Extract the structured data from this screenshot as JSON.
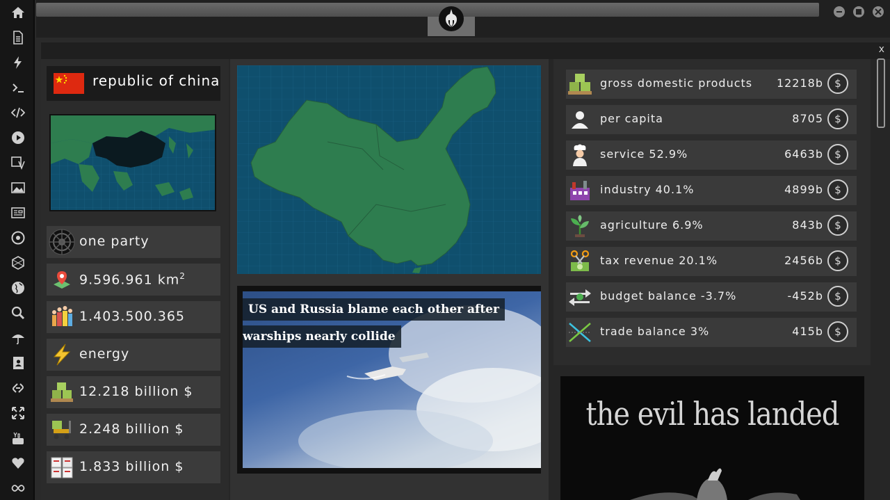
{
  "sidebar": {
    "items": [
      {
        "icon": "home-icon"
      },
      {
        "icon": "document-icon"
      },
      {
        "icon": "lightning-icon"
      },
      {
        "icon": "terminal-icon"
      },
      {
        "icon": "code-icon"
      },
      {
        "icon": "play-icon"
      },
      {
        "icon": "translate-icon"
      },
      {
        "icon": "image-icon"
      },
      {
        "icon": "news-icon"
      },
      {
        "icon": "empire-icon"
      },
      {
        "icon": "hexagon-icon"
      },
      {
        "icon": "globe-icon"
      },
      {
        "icon": "search-icon"
      },
      {
        "icon": "umbrella-icon"
      },
      {
        "icon": "contacts-icon"
      },
      {
        "icon": "link-icon"
      },
      {
        "icon": "fullscreen-icon"
      },
      {
        "icon": "youtube-icon"
      },
      {
        "icon": "heart-icon"
      },
      {
        "icon": "infinity-icon"
      }
    ]
  },
  "window": {
    "close_label": "x"
  },
  "country": {
    "name": "republic of china",
    "flag_color": "#de2910",
    "government": "one party",
    "area_value": "9.596.961 km",
    "area_sup": "2",
    "population": "1.403.500.365",
    "resource": "energy",
    "gdp": "12.218 billion $",
    "export": "2.248 billion $",
    "import": "1.833 billion $"
  },
  "news": {
    "headline_line1": "US and Russia blame each other after",
    "headline_line2": "warships nearly collide"
  },
  "economy": {
    "currency_symbol": "$",
    "rows": [
      {
        "label": "gross domestic products",
        "value": "12218b",
        "icon": "money-pallet-icon"
      },
      {
        "label": "per capita",
        "value": "8705",
        "icon": "person-icon"
      },
      {
        "label": "service 52.9%",
        "value": "6463b",
        "icon": "chef-icon"
      },
      {
        "label": "industry 40.1%",
        "value": "4899b",
        "icon": "factory-icon"
      },
      {
        "label": "agriculture 6.9%",
        "value": "843b",
        "icon": "plant-icon"
      },
      {
        "label": "tax revenue 20.1%",
        "value": "2456b",
        "icon": "scissors-money-icon"
      },
      {
        "label": "budget balance -3.7%",
        "value": "-452b",
        "icon": "exchange-arrows-icon"
      },
      {
        "label": "trade balance 3%",
        "value": "415b",
        "icon": "trade-cross-icon"
      }
    ]
  },
  "promo": {
    "title": "the evil has landed"
  },
  "colors": {
    "map_water": "#0f4f6d",
    "map_land": "#2e7d4f",
    "panel": "#262626"
  }
}
